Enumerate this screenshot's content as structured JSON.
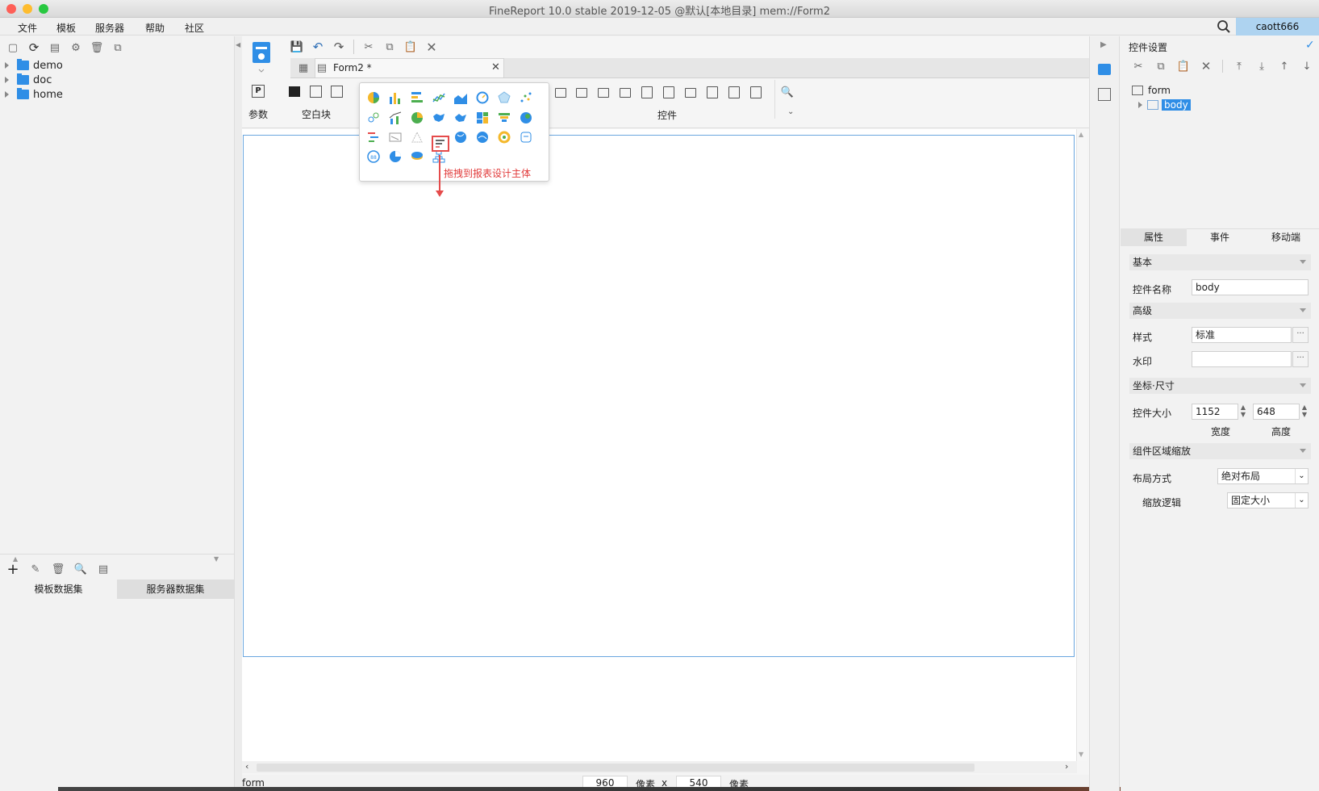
{
  "window": {
    "title": "FineReport 10.0 stable 2019-12-05 @默认[本地目录]    mem://Form2",
    "user": "caott666"
  },
  "menu": [
    "文件",
    "模板",
    "服务器",
    "帮助",
    "社区"
  ],
  "left_panel": {
    "tree": [
      {
        "label": "demo"
      },
      {
        "label": "doc"
      },
      {
        "label": "home"
      }
    ],
    "dataset_tabs": [
      "模板数据集",
      "服务器数据集"
    ]
  },
  "editor": {
    "doc_tab": "Form2 *",
    "ribbon": {
      "param_label": "参数",
      "blank_block_label": "空白块",
      "widget_label": "控件"
    },
    "drag_hint": "拖拽到报表设计主体",
    "status": {
      "component": "form",
      "width": "960",
      "width_unit": "像素",
      "times": "x",
      "height": "540",
      "height_unit": "像素"
    }
  },
  "right_panel": {
    "title": "控件设置",
    "tree": {
      "root": "form",
      "child": "body"
    },
    "tabs": [
      "属性",
      "事件",
      "移动端"
    ],
    "sections": {
      "basic": "基本",
      "advanced": "高级",
      "coords": "坐标·尺寸",
      "zoom": "组件区域缩放"
    },
    "fields": {
      "name_label": "控件名称",
      "name_value": "body",
      "style_label": "样式",
      "style_value": "标准",
      "watermark_label": "水印",
      "watermark_value": "",
      "size_label": "控件大小",
      "size_width": "1152",
      "size_height": "648",
      "width_caption": "宽度",
      "height_caption": "高度",
      "layout_label": "布局方式",
      "layout_value": "绝对布局",
      "scale_label": "缩放逻辑",
      "scale_value": "固定大小"
    }
  },
  "colors": {
    "accent": "#2f8ee6",
    "selection": "#aed3f0",
    "drag_hint": "#e13a3a",
    "form_border": "#6aa6df"
  }
}
